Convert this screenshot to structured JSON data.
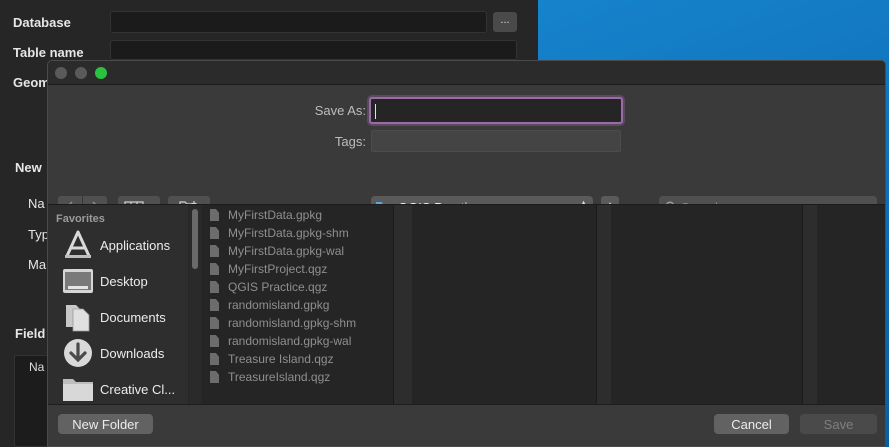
{
  "background_dialog": {
    "labels": {
      "database": "Database",
      "table_name": "Table name",
      "geometry": "Geom",
      "new_field": "New",
      "name": "Na",
      "type": "Typ",
      "max": "Ma",
      "fields": "Field",
      "fields_col": "Na"
    },
    "browse_label": "..."
  },
  "sheet": {
    "save_as_label": "Save As:",
    "save_as_value": "",
    "tags_label": "Tags:",
    "tags_value": "",
    "location": "QGIS Practice",
    "search_placeholder": "Search",
    "sidebar": {
      "heading": "Favorites",
      "items": [
        {
          "label": "Applications",
          "icon": "applications-icon"
        },
        {
          "label": "Desktop",
          "icon": "desktop-icon"
        },
        {
          "label": "Documents",
          "icon": "documents-icon"
        },
        {
          "label": "Downloads",
          "icon": "downloads-icon"
        },
        {
          "label": "Creative Cl...",
          "icon": "folder-icon"
        }
      ]
    },
    "files": [
      "MyFirstData.gpkg",
      "MyFirstData.gpkg-shm",
      "MyFirstData.gpkg-wal",
      "MyFirstProject.qgz",
      "QGIS Practice.qgz",
      "randomisland.gpkg",
      "randomisland.gpkg-shm",
      "randomisland.gpkg-wal",
      "Treasure Island.qgz",
      "TreasureIsland.qgz"
    ],
    "buttons": {
      "new_folder": "New Folder",
      "cancel": "Cancel",
      "save": "Save"
    },
    "colors": {
      "focus_ring": "#9b6ba7",
      "zoom_light": "#2ac23f",
      "folder_blue": "#5aa7d8"
    }
  }
}
